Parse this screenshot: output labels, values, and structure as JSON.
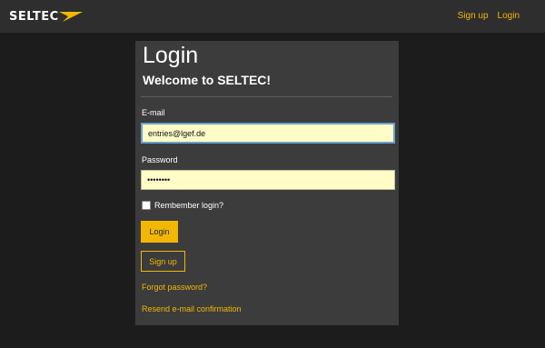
{
  "brand": {
    "name": "SELTEC",
    "accent_color": "#f2b705"
  },
  "nav": {
    "signup_label": "Sign up",
    "login_label": "Login"
  },
  "form": {
    "title": "Login",
    "subtitle": "Welcome to SELTEC!",
    "email": {
      "label": "E-mail",
      "value": "entries@lgef.de"
    },
    "password": {
      "label": "Password",
      "value": "••••••••"
    },
    "remember": {
      "label": "Rembember login?",
      "checked": false
    },
    "login_button": "Login",
    "signup_button": "Sign up",
    "forgot_link": "Forgot password?",
    "resend_link": "Resend e-mail confirmation"
  }
}
